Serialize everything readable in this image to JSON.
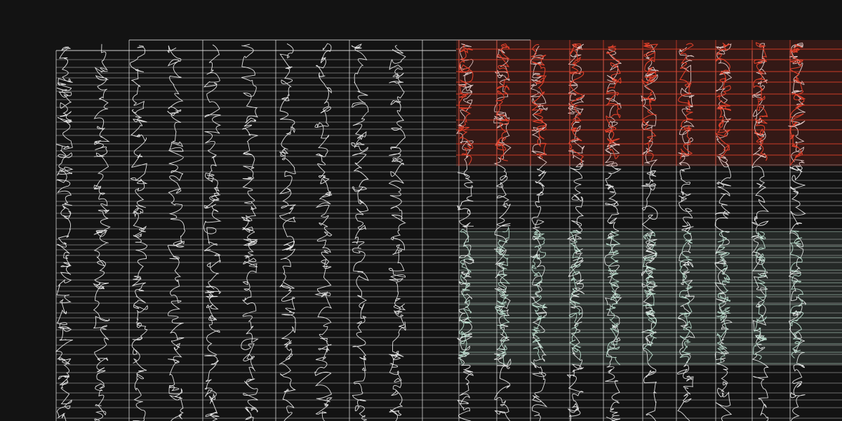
{
  "artwork": {
    "background_color": "#131313",
    "line_color": "#f4f4f4",
    "accent_red": "#e8412a",
    "accent_mint": "#c8ecdc"
  }
}
